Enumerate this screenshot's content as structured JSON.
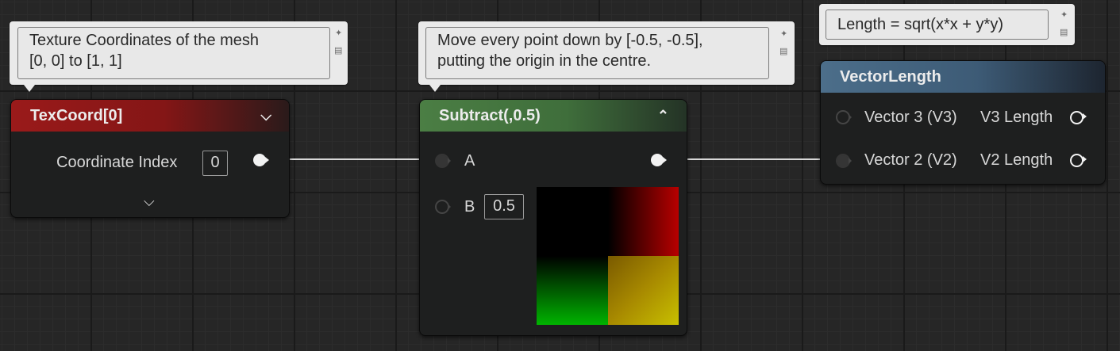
{
  "comments": {
    "texcoord": "Texture Coordinates of the mesh\n[0, 0] to [1, 1]",
    "subtract": "Move every point down by [-0.5, -0.5],\nputting the origin in the centre.",
    "vectorlength": "Length = sqrt(x*x + y*y)"
  },
  "nodes": {
    "texcoord": {
      "title": "TexCoord[0]",
      "color": "#9a1a1a",
      "pins": {
        "coordinate_index_label": "Coordinate Index",
        "coordinate_index_value": "0"
      }
    },
    "subtract": {
      "title": "Subtract(,0.5)",
      "color": "#4b7e44",
      "pins": {
        "a_label": "A",
        "b_label": "B",
        "b_value": "0.5"
      }
    },
    "vectorlength": {
      "title": "VectorLength",
      "color": "#4c6e8a",
      "pins": {
        "v3_in": "Vector 3 (V3)",
        "v3_out": "V3 Length",
        "v2_in": "Vector 2 (V2)",
        "v2_out": "V2 Length"
      }
    }
  },
  "icons": {
    "comment_pin": "pin-icon",
    "comment_bubble": "comment-bubble-icon",
    "collapse": "chevron-down-icon",
    "expand": "chevron-up-icon"
  }
}
